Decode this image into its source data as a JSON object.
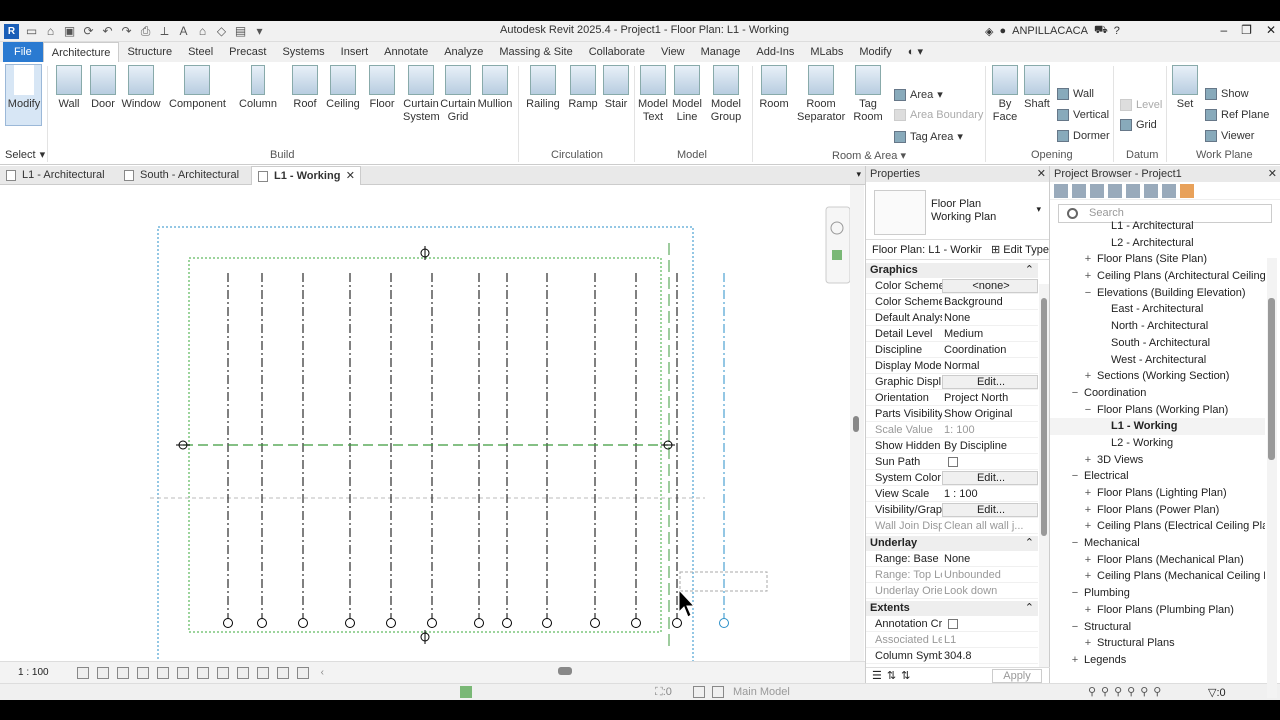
{
  "window": {
    "title": "Autodesk Revit 2025.4 - Project1 - Floor Plan: L1 - Working",
    "user": "ANPILLACACA"
  },
  "ribbon_tabs": [
    "File",
    "Architecture",
    "Structure",
    "Steel",
    "Precast",
    "Systems",
    "Insert",
    "Annotate",
    "Analyze",
    "Massing & Site",
    "Collaborate",
    "View",
    "Manage",
    "Add-Ins",
    "MLabs",
    "Modify"
  ],
  "active_ribbon_tab": "Architecture",
  "select": {
    "modify": "Modify",
    "select_label": "Select"
  },
  "build": {
    "label": "Build",
    "wall": "Wall",
    "door": "Door",
    "window": "Window",
    "component": "Component",
    "column": "Column",
    "roof": "Roof",
    "ceiling": "Ceiling",
    "floor": "Floor",
    "curtain_system": "Curtain System",
    "curtain_grid": "Curtain Grid",
    "mullion": "Mullion"
  },
  "circulation": {
    "label": "Circulation",
    "railing": "Railing",
    "ramp": "Ramp",
    "stair": "Stair"
  },
  "model": {
    "label": "Model",
    "model_text": "Model Text",
    "model_line": "Model Line",
    "model_group": "Model Group"
  },
  "room_area": {
    "label": "Room & Area",
    "room": "Room",
    "room_separator": "Room Separator",
    "tag_room": "Tag Room",
    "area": "Area",
    "area_boundary": "Area Boundary",
    "tag_area": "Tag Area"
  },
  "opening": {
    "label": "Opening",
    "by_face": "By Face",
    "shaft": "Shaft",
    "wall": "Wall",
    "vertical": "Vertical",
    "dormer": "Dormer"
  },
  "datum": {
    "label": "Datum",
    "level": "Level",
    "grid": "Grid"
  },
  "work_plane": {
    "label": "Work Plane",
    "set": "Set",
    "show": "Show",
    "ref_plane": "Ref Plane",
    "viewer": "Viewer"
  },
  "view_tabs": [
    {
      "label": "L1 - Architectural"
    },
    {
      "label": "South - Architectural"
    },
    {
      "label": "L1 - Working"
    }
  ],
  "status": {
    "scale": "1 : 100",
    "count_left": "0",
    "main_model": "Main Model",
    "filter_count": "0"
  },
  "properties": {
    "title": "Properties",
    "type_name": "Floor Plan",
    "type_sub": "Working Plan",
    "instance": "Floor Plan: L1 - Workir",
    "edit_type": "Edit Type",
    "apply": "Apply",
    "sections": {
      "graphics": "Graphics",
      "underlay": "Underlay",
      "extents": "Extents"
    },
    "graphics": [
      {
        "k": "Color Scheme",
        "v": "<none>",
        "btn": true
      },
      {
        "k": "Color Scheme ...",
        "v": "Background"
      },
      {
        "k": "Default Analys...",
        "v": "None"
      },
      {
        "k": "Detail Level",
        "v": "Medium"
      },
      {
        "k": "Discipline",
        "v": "Coordination"
      },
      {
        "k": "Display Model",
        "v": "Normal"
      },
      {
        "k": "Graphic Displ...",
        "v": "Edit...",
        "btn": true
      },
      {
        "k": "Orientation",
        "v": "Project North"
      },
      {
        "k": "Parts Visibility",
        "v": "Show Original"
      },
      {
        "k": "Scale Value",
        "v": "1: 100",
        "dim": true
      },
      {
        "k": "Show Hidden ...",
        "v": "By Discipline"
      },
      {
        "k": "Sun Path",
        "v": "",
        "checkbox": true
      },
      {
        "k": "System Color ...",
        "v": "Edit...",
        "btn": true
      },
      {
        "k": "View Scale",
        "v": "1 : 100"
      },
      {
        "k": "Visibility/Grap...",
        "v": "Edit...",
        "btn": true
      },
      {
        "k": "Wall Join Disp...",
        "v": "Clean all wall j...",
        "dim": true
      }
    ],
    "underlay": [
      {
        "k": "Range: Base L...",
        "v": "None"
      },
      {
        "k": "Range: Top Le...",
        "v": "Unbounded",
        "dim": true
      },
      {
        "k": "Underlay Orie...",
        "v": "Look down",
        "dim": true
      }
    ],
    "extents": [
      {
        "k": "Annotation Cr...",
        "v": "",
        "checkbox": true
      },
      {
        "k": "Associated Le...",
        "v": "L1",
        "dim": true
      },
      {
        "k": "Column Symb...",
        "v": "304.8"
      }
    ]
  },
  "browser": {
    "title": "Project Browser - Project1",
    "search_placeholder": "Search",
    "items": [
      {
        "label": "L1 - Architectural",
        "level": 3
      },
      {
        "label": "L2 - Architectural",
        "level": 3
      },
      {
        "label": "Floor Plans (Site Plan)",
        "level": 2,
        "toggle": "+"
      },
      {
        "label": "Ceiling Plans (Architectural Ceiling Pla",
        "level": 2,
        "toggle": "+"
      },
      {
        "label": "Elevations (Building Elevation)",
        "level": 2,
        "toggle": "−"
      },
      {
        "label": "East - Architectural",
        "level": 3
      },
      {
        "label": "North - Architectural",
        "level": 3
      },
      {
        "label": "South - Architectural",
        "level": 3
      },
      {
        "label": "West - Architectural",
        "level": 3
      },
      {
        "label": "Sections (Working Section)",
        "level": 2,
        "toggle": "+"
      },
      {
        "label": "Coordination",
        "level": 1,
        "toggle": "−"
      },
      {
        "label": "Floor Plans (Working Plan)",
        "level": 2,
        "toggle": "−"
      },
      {
        "label": "L1 - Working",
        "level": 3,
        "bold": true
      },
      {
        "label": "L2 - Working",
        "level": 3
      },
      {
        "label": "3D Views",
        "level": 2,
        "toggle": "+"
      },
      {
        "label": "Electrical",
        "level": 1,
        "toggle": "−"
      },
      {
        "label": "Floor Plans (Lighting Plan)",
        "level": 2,
        "toggle": "+"
      },
      {
        "label": "Floor Plans (Power Plan)",
        "level": 2,
        "toggle": "+"
      },
      {
        "label": "Ceiling Plans (Electrical Ceiling Plan)",
        "level": 2,
        "toggle": "+"
      },
      {
        "label": "Mechanical",
        "level": 1,
        "toggle": "−"
      },
      {
        "label": "Floor Plans (Mechanical Plan)",
        "level": 2,
        "toggle": "+"
      },
      {
        "label": "Ceiling Plans (Mechanical Ceiling Plan",
        "level": 2,
        "toggle": "+"
      },
      {
        "label": "Plumbing",
        "level": 1,
        "toggle": "−"
      },
      {
        "label": "Floor Plans (Plumbing Plan)",
        "level": 2,
        "toggle": "+"
      },
      {
        "label": "Structural",
        "level": 1,
        "toggle": "−"
      },
      {
        "label": "Structural Plans",
        "level": 2,
        "toggle": "+"
      },
      {
        "label": "Legends",
        "level": 1,
        "toggle": "+"
      }
    ]
  }
}
